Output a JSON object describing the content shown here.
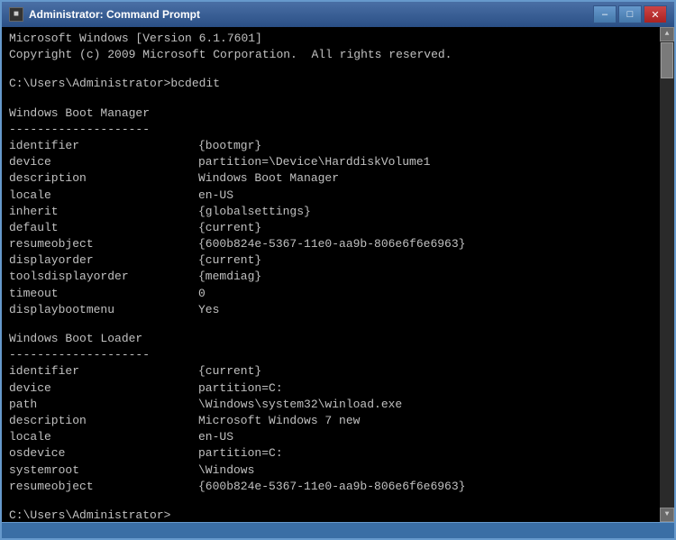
{
  "window": {
    "title": "Administrator: Command Prompt",
    "icon": "■"
  },
  "titlebar": {
    "minimize_label": "–",
    "maximize_label": "□",
    "close_label": "✕"
  },
  "console": {
    "lines": [
      {
        "type": "header",
        "text": "Microsoft Windows [Version 6.1.7601]"
      },
      {
        "type": "header",
        "text": "Copyright (c) 2009 Microsoft Corporation.  All rights reserved."
      },
      {
        "type": "blank"
      },
      {
        "type": "prompt",
        "text": "C:\\Users\\Administrator>bcdedit"
      },
      {
        "type": "blank"
      },
      {
        "type": "section",
        "text": "Windows Boot Manager"
      },
      {
        "type": "divider",
        "text": "--------------------"
      },
      {
        "type": "keyval",
        "key": "identifier",
        "val": "{bootmgr}"
      },
      {
        "type": "keyval",
        "key": "device",
        "val": "partition=\\Device\\HarddiskVolume1"
      },
      {
        "type": "keyval",
        "key": "description",
        "val": "Windows Boot Manager"
      },
      {
        "type": "keyval",
        "key": "locale",
        "val": "en-US"
      },
      {
        "type": "keyval",
        "key": "inherit",
        "val": "{globalsettings}"
      },
      {
        "type": "keyval",
        "key": "default",
        "val": "{current}"
      },
      {
        "type": "keyval",
        "key": "resumeobject",
        "val": "{600b824e-5367-11e0-aa9b-806e6f6e6963}"
      },
      {
        "type": "keyval",
        "key": "displayorder",
        "val": "{current}"
      },
      {
        "type": "keyval",
        "key": "toolsdisplayorder",
        "val": "{memdiag}"
      },
      {
        "type": "keyval",
        "key": "timeout",
        "val": "0"
      },
      {
        "type": "keyval",
        "key": "displaybootmenu",
        "val": "Yes"
      },
      {
        "type": "blank"
      },
      {
        "type": "section",
        "text": "Windows Boot Loader"
      },
      {
        "type": "divider",
        "text": "--------------------"
      },
      {
        "type": "keyval",
        "key": "identifier",
        "val": "{current}"
      },
      {
        "type": "keyval",
        "key": "device",
        "val": "partition=C:"
      },
      {
        "type": "keyval",
        "key": "path",
        "val": "\\Windows\\system32\\winload.exe"
      },
      {
        "type": "keyval",
        "key": "description",
        "val": "Microsoft Windows 7 new"
      },
      {
        "type": "keyval",
        "key": "locale",
        "val": "en-US"
      },
      {
        "type": "keyval",
        "key": "osdevice",
        "val": "partition=C:"
      },
      {
        "type": "keyval",
        "key": "systemroot",
        "val": "\\Windows"
      },
      {
        "type": "keyval",
        "key": "resumeobject",
        "val": "{600b824e-5367-11e0-aa9b-806e6f6e6963}"
      },
      {
        "type": "blank"
      },
      {
        "type": "prompt",
        "text": "C:\\Users\\Administrator>"
      }
    ]
  }
}
